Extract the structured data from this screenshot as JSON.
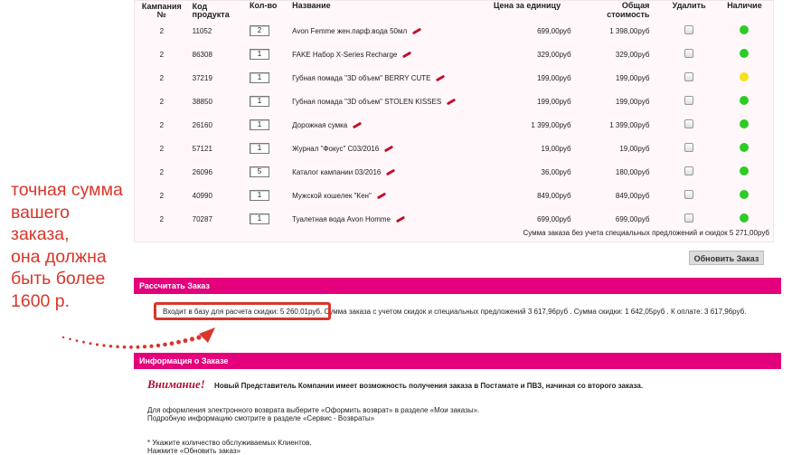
{
  "table": {
    "headers": {
      "campaign": "Кампания",
      "campaign_no": "№",
      "code": "Код",
      "code2": "продукта",
      "qty": "Кол-во",
      "name": "Название",
      "unit_price": "Цена за единицу",
      "total": "Общая стоимость",
      "delete": "Удалить",
      "availability": "Наличие"
    },
    "rows": [
      {
        "campaign": "2",
        "code": "11052",
        "qty": "2",
        "name": "Avon Femme жен.парф.вода 50мл",
        "price": "699,00руб",
        "total": "1 398,00руб",
        "status": "#2dcc24"
      },
      {
        "campaign": "2",
        "code": "86308",
        "qty": "1",
        "name": "FAKE Набор X-Series Recharge",
        "price": "329,00руб",
        "total": "329,00руб",
        "status": "#2dcc24"
      },
      {
        "campaign": "2",
        "code": "37219",
        "qty": "1",
        "name": "Губная помада \"3D объем\" BERRY CUTE",
        "price": "199,00руб",
        "total": "199,00руб",
        "status": "#f5e11b"
      },
      {
        "campaign": "2",
        "code": "38850",
        "qty": "1",
        "name": "Губная помада \"3D объем\" STOLEN KISSES",
        "price": "199,00руб",
        "total": "199,00руб",
        "status": "#2dcc24"
      },
      {
        "campaign": "2",
        "code": "26160",
        "qty": "1",
        "name": "Дорожная сумка",
        "price": "1 399,00руб",
        "total": "1 399,00руб",
        "status": "#2dcc24"
      },
      {
        "campaign": "2",
        "code": "57121",
        "qty": "1",
        "name": "Журнал \"Фокус\" С03/2016",
        "price": "19,00руб",
        "total": "19,00руб",
        "status": "#2dcc24"
      },
      {
        "campaign": "2",
        "code": "26096",
        "qty": "5",
        "name": "Каталог кампании 03/2016",
        "price": "36,00руб",
        "total": "180,00руб",
        "status": "#2dcc24"
      },
      {
        "campaign": "2",
        "code": "40990",
        "qty": "1",
        "name": "Мужской кошелек \"Кен\"",
        "price": "849,00руб",
        "total": "849,00руб",
        "status": "#2dcc24"
      },
      {
        "campaign": "2",
        "code": "70287",
        "qty": "1",
        "name": "Туалетная вода Avon Homme",
        "price": "699,00руб",
        "total": "699,00руб",
        "status": "#2dcc24"
      }
    ],
    "summary": "Сумма заказа без учета специальных предложений и скидок 5 271,00руб"
  },
  "update_button": "Обновить Заказ",
  "calc_bar": "Рассчитать Заказ",
  "calc_highlight": "Входит в базу для расчета скидки: 5 260,01руб",
  "calc_rest": ". Сумма заказа с учетом скидок и специальных предложений 3 617,96руб . Сумма скидки: 1 642,05руб . К оплате: 3 617,96руб.",
  "annotation_lines": [
    "точная сумма",
    "вашего",
    "заказа,",
    "она должна",
    "быть более",
    "1600 р."
  ],
  "info_bar": "Информация о Заказе",
  "attention_word": "Внимание!",
  "attention_text": "Новый Представитель Компании имеет возможность получения заказа в Постамате и ПВЗ, начиная со второго заказа.",
  "return_line1": "Для оформления электронного возврата выберите «Оформить возврат» в разделе «Мои заказы».",
  "return_line2": "Подробную информацию смотрите в разделе «Сервис - Возвраты»",
  "clients_line1": "* Укажите количество обслуживаемых Клиентов.",
  "clients_line2": "Нажмите «Обновить заказ»",
  "colors": {
    "accent": "#e4007c",
    "annotation": "#d9352a",
    "available": "#2dcc24",
    "limited": "#f5e11b"
  }
}
